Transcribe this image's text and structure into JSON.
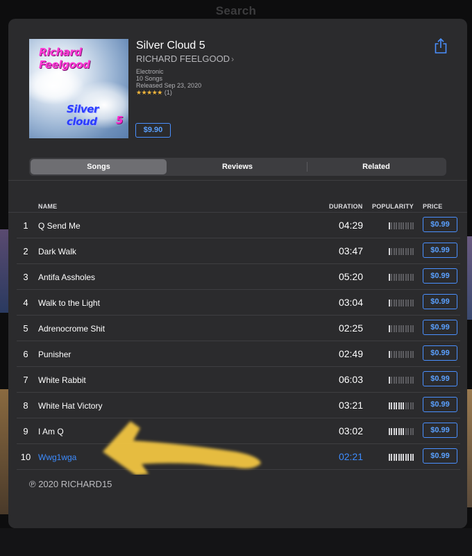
{
  "background": {
    "title": "Search"
  },
  "album": {
    "title": "Silver Cloud 5",
    "artist": "RICHARD FEELGOOD",
    "genre": "Electronic",
    "song_count": "10 Songs",
    "released": "Released Sep 23, 2020",
    "stars": "★★★★★",
    "rating_count": "(1)",
    "price": "$9.90",
    "cover": {
      "line1": "Richard Feelgood",
      "line2": "Silver cloud",
      "line3": "5"
    }
  },
  "tabs": [
    {
      "label": "Songs",
      "active": true
    },
    {
      "label": "Reviews",
      "active": false
    },
    {
      "label": "Related",
      "active": false
    }
  ],
  "columns": {
    "name": "NAME",
    "duration": "DURATION",
    "popularity": "POPULARITY",
    "price": "PRICE"
  },
  "songs": [
    {
      "num": "1",
      "name": "Q Send Me",
      "duration": "04:29",
      "popularity": 0.1,
      "price": "$0.99"
    },
    {
      "num": "2",
      "name": "Dark Walk",
      "duration": "03:47",
      "popularity": 0.1,
      "price": "$0.99"
    },
    {
      "num": "3",
      "name": "Antifa Assholes",
      "duration": "05:20",
      "popularity": 0.1,
      "price": "$0.99"
    },
    {
      "num": "4",
      "name": "Walk to the Light",
      "duration": "03:04",
      "popularity": 0.1,
      "price": "$0.99"
    },
    {
      "num": "5",
      "name": "Adrenocrome Shit",
      "duration": "02:25",
      "popularity": 0.1,
      "price": "$0.99"
    },
    {
      "num": "6",
      "name": "Punisher",
      "duration": "02:49",
      "popularity": 0.1,
      "price": "$0.99"
    },
    {
      "num": "7",
      "name": "White Rabbit",
      "duration": "06:03",
      "popularity": 0.1,
      "price": "$0.99"
    },
    {
      "num": "8",
      "name": "White Hat Victory",
      "duration": "03:21",
      "popularity": 0.6,
      "price": "$0.99"
    },
    {
      "num": "9",
      "name": "I Am Q",
      "duration": "03:02",
      "popularity": 0.6,
      "price": "$0.99"
    },
    {
      "num": "10",
      "name": "Wwg1wga",
      "duration": "02:21",
      "popularity": 1.0,
      "price": "$0.99",
      "playing": true
    }
  ],
  "copyright": "℗ 2020 RICHARD15",
  "colors": {
    "accent": "#4a90ff",
    "stars": "#f0b63c",
    "highlight_arrow": "#f5c842"
  }
}
